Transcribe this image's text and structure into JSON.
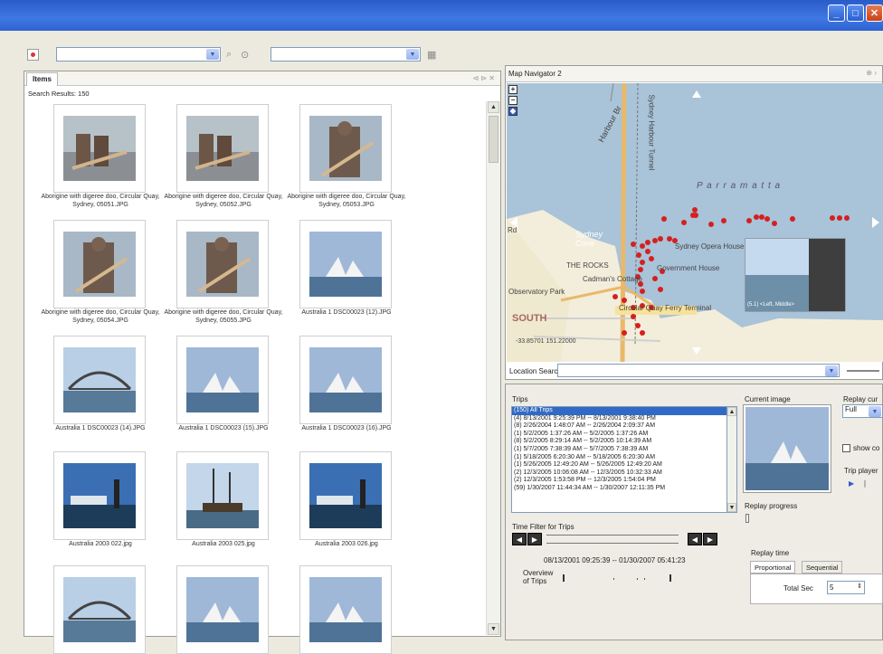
{
  "window": {
    "min": "_",
    "max": "□",
    "close": "✕"
  },
  "toolbar": {
    "search_value": "",
    "filter_value": ""
  },
  "items_panel": {
    "tab": "Items",
    "results": "Search Results: 150",
    "items": [
      {
        "caption": "Aborigine with digeree doo, Circular Quay, Sydney, 05051.JPG",
        "scene": "aborigine"
      },
      {
        "caption": "Aborigine with digeree doo, Circular Quay, Sydney, 05052.JPG",
        "scene": "aborigine"
      },
      {
        "caption": "Aborigine with digeree doo, Circular Quay, Sydney, 05053.JPG",
        "scene": "aborigine-portrait"
      },
      {
        "caption": "Aborigine with digeree doo, Circular Quay, Sydney, 05054.JPG",
        "scene": "aborigine-portrait"
      },
      {
        "caption": "Aborigine with digeree doo, Circular Quay, Sydney, 05055.JPG",
        "scene": "aborigine-portrait"
      },
      {
        "caption": "Australia 1 DSC00023 (12).JPG",
        "scene": "opera"
      },
      {
        "caption": "Australia 1 DSC00023 (14).JPG",
        "scene": "bridge"
      },
      {
        "caption": "Australia 1 DSC00023 (15).JPG",
        "scene": "opera"
      },
      {
        "caption": "Australia 1 DSC00023 (16).JPG",
        "scene": "opera"
      },
      {
        "caption": "Australia 2003 022.jpg",
        "scene": "harbour"
      },
      {
        "caption": "Australia 2003 025.jpg",
        "scene": "ship"
      },
      {
        "caption": "Australia 2003 026.jpg",
        "scene": "harbour"
      },
      {
        "caption": "",
        "scene": "bridge"
      },
      {
        "caption": "",
        "scene": "opera"
      },
      {
        "caption": "",
        "scene": "opera"
      }
    ]
  },
  "map_panel": {
    "title": "Map Navigator 2",
    "labels": {
      "road1": "Harbour Br",
      "road2": "Sydney Harbour Tunnel",
      "road3": "Rd",
      "water": "P a r r a m a t t a",
      "cove": "Sydney Cove",
      "rocks": "THE ROCKS",
      "opera": "Sydney Opera House",
      "govt": "Government House",
      "cadman": "Cadman's Cottage",
      "obs": "Observatory Park",
      "south": "SOUTH",
      "quay": "Circular Quay Ferry Terminal",
      "coords": "-33.85701  151.22000",
      "overlay": "(5.1) <Left, Middle>"
    },
    "location_search_label": "Location Search:"
  },
  "trips": {
    "label": "Trips",
    "items": [
      "(150) All Trips",
      "(4) 8/13/2001 9:25:39 PM -- 8/13/2001 9:38:40 PM",
      "(8) 2/26/2004 1:48:07 AM -- 2/26/2004 2:09:37 AM",
      "(1) 5/2/2005 1:37:26 AM -- 5/2/2005 1:37:26 AM",
      "(8) 5/2/2005 8:29:14 AM -- 5/2/2005 10:14:39 AM",
      "(1) 5/7/2005 7:38:39 AM -- 5/7/2005 7:38:39 AM",
      "(1) 5/18/2005 6:20:30 AM -- 5/18/2005 6:20:30 AM",
      "(1) 5/26/2005 12:49:20 AM -- 5/26/2005 12:49:20 AM",
      "(2) 12/3/2005 10:06:08 AM -- 12/3/2005 10:32:33 AM",
      "(2) 12/3/2005 1:53:58 PM -- 12/3/2005 1:54:04 PM",
      "(59) 1/30/2007 11:44:34 AM -- 1/30/2007 12:11:35 PM"
    ],
    "time_filter_label": "Time Filter for Trips",
    "time_range": "08/13/2001 09:25:39 -- 01/30/2007 05:41:23",
    "overview_label": "Overview of Trips"
  },
  "replay": {
    "current_image": "Current image",
    "replay_curve": "Replay cur",
    "replay_curve_value": "Full",
    "show_checkbox": "show co",
    "trip_player": "Trip player",
    "progress": "Replay progress",
    "time_label": "Replay time",
    "tab_proportional": "Proportional",
    "tab_sequential": "Sequential",
    "total_sec": "Total Sec",
    "total_sec_value": "5"
  }
}
